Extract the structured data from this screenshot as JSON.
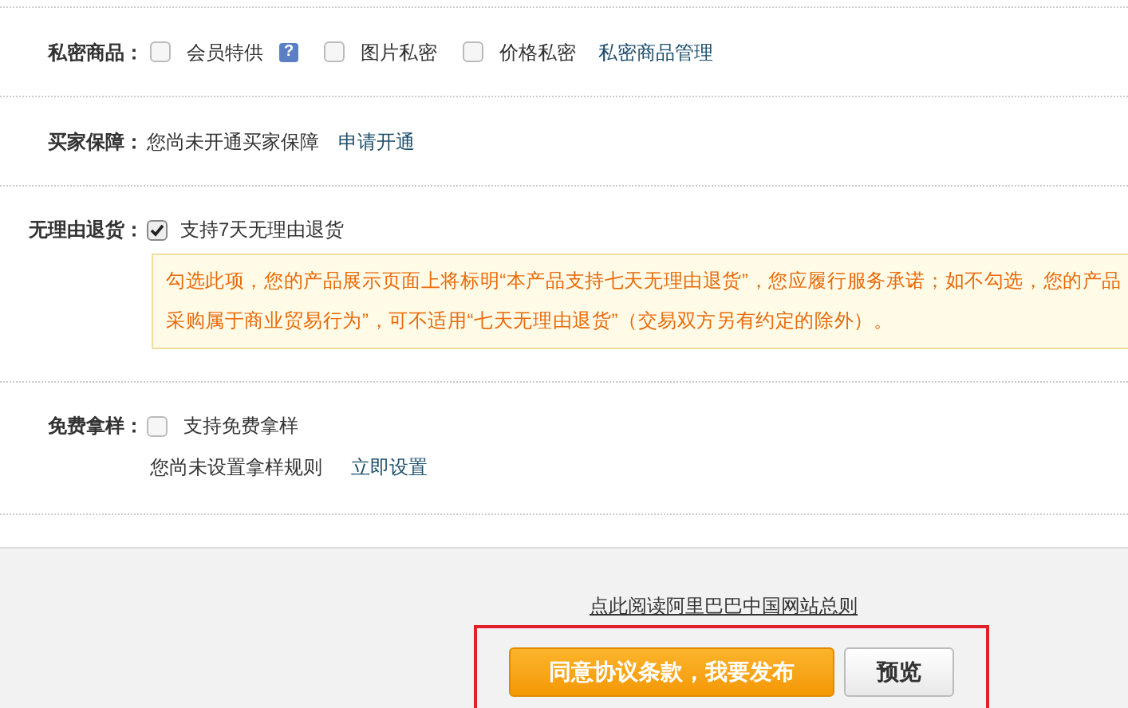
{
  "rows": [
    {
      "kind": "options",
      "label": "私密商品：",
      "options": [
        {
          "text": "会员特供",
          "checked": false,
          "help": "?"
        },
        {
          "text": "图片私密",
          "checked": false
        },
        {
          "text": "价格私密",
          "checked": false
        }
      ],
      "link": "私密商品管理"
    },
    {
      "kind": "status",
      "label": "买家保障：",
      "text": "您尚未开通买家保障",
      "link": "申请开通"
    },
    {
      "kind": "notice",
      "label": "无理由退货：",
      "option": {
        "text": "支持7天无理由退货",
        "checked": true
      },
      "notice": [
        "勾选此项，您的产品展示页面上将标明“本产品支持七天无理由退货”，您应履行服务承诺；如不勾选，您的产品",
        "采购属于商业贸易行为”，可不适用“七天无理由退货”（交易双方另有约定的除外）。"
      ]
    },
    {
      "kind": "sub",
      "label": "免费拿样：",
      "option": {
        "text": "支持免费拿样",
        "checked": false
      },
      "text": "您尚未设置拿样规则",
      "link": "立即设置"
    }
  ],
  "footer": {
    "rules_link": "点此阅读阿里巴巴中国网站总则",
    "submit": "同意协议条款，我要发布",
    "preview": "预览"
  }
}
